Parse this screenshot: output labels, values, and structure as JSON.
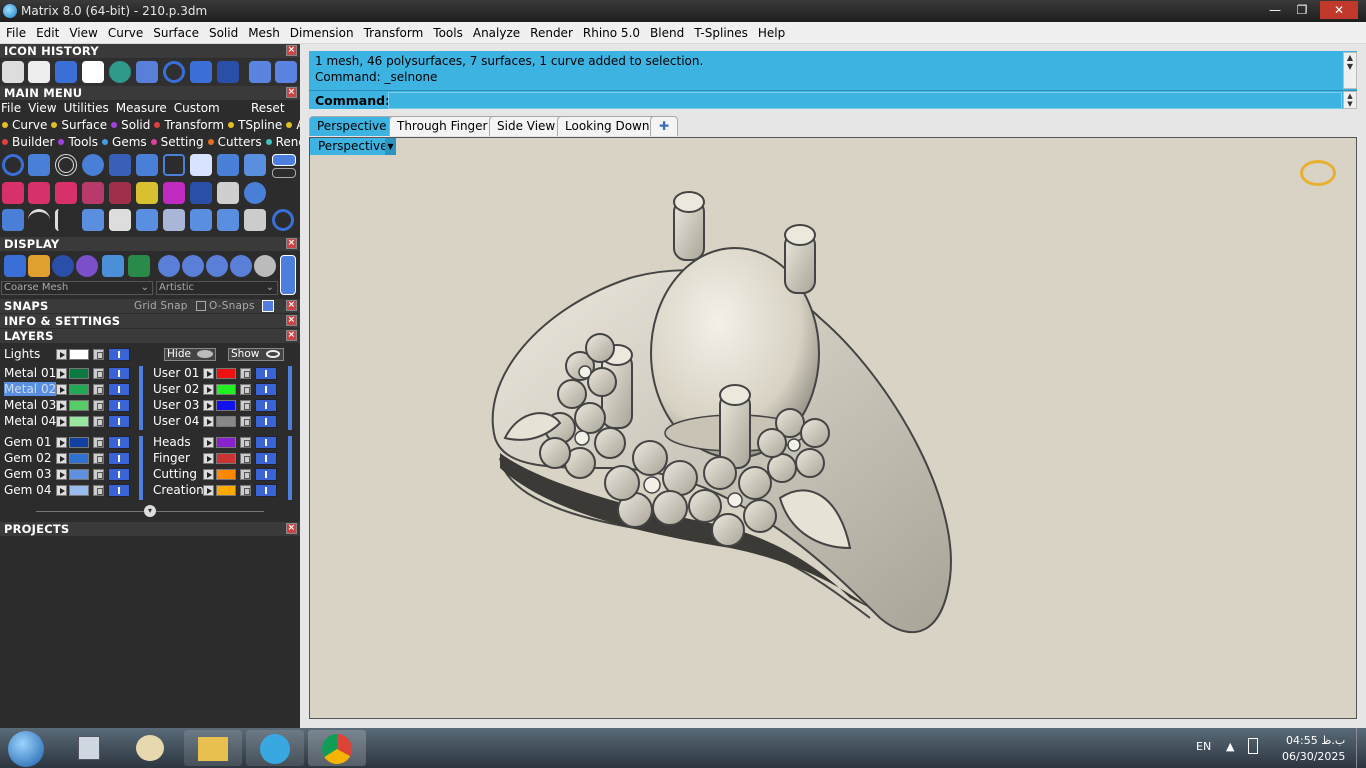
{
  "window": {
    "title": "Matrix 8.0 (64-bit) - 210.p.3dm",
    "min": "—",
    "restore": "❐",
    "close": "✕"
  },
  "menubar": [
    "File",
    "Edit",
    "View",
    "Curve",
    "Surface",
    "Solid",
    "Mesh",
    "Dimension",
    "Transform",
    "Tools",
    "Analyze",
    "Render",
    "Rhino 5.0",
    "Blend",
    "T-Splines",
    "Help"
  ],
  "panels": {
    "icon_history": "ICON HISTORY",
    "main_menu": "MAIN MENU",
    "display": "DISPLAY",
    "snaps": "SNAPS",
    "info_settings": "INFO & SETTINGS",
    "layers": "LAYERS",
    "projects": "PROJECTS"
  },
  "main_menu": {
    "items": [
      "File",
      "View",
      "Utilities",
      "Measure",
      "Custom"
    ],
    "reset": "Reset",
    "row1": [
      {
        "label": "Curve",
        "color": "#e0c020"
      },
      {
        "label": "Surface",
        "color": "#e0c020"
      },
      {
        "label": "Solid",
        "color": "#a040e0"
      },
      {
        "label": "Transform",
        "color": "#e04040"
      },
      {
        "label": "TSpline",
        "color": "#e0c020"
      },
      {
        "label": "Art",
        "color": "#e0c020"
      }
    ],
    "row2": [
      {
        "label": "Builder",
        "color": "#e04040"
      },
      {
        "label": "Tools",
        "color": "#a040e0"
      },
      {
        "label": "Gems",
        "color": "#40a0e0"
      },
      {
        "label": "Setting",
        "color": "#e040a0"
      },
      {
        "label": "Cutters",
        "color": "#e07020"
      },
      {
        "label": "Render",
        "color": "#40c0c0"
      }
    ]
  },
  "display": {
    "mesh_option": "Coarse Mesh",
    "style_option": "Artistic"
  },
  "snaps": {
    "grid_snap": "Grid Snap",
    "o_snaps": "O-Snaps"
  },
  "layers": {
    "lights": "Lights",
    "hide": "Hide",
    "show": "Show",
    "left": [
      {
        "name": "Metal 01",
        "color": "#0a7a40"
      },
      {
        "name": "Metal 02",
        "color": "#22a855"
      },
      {
        "name": "Metal 03",
        "color": "#55cc66"
      },
      {
        "name": "Metal 04",
        "color": "#99e6a0"
      },
      {
        "name": "Gem 01",
        "color": "#1040a0"
      },
      {
        "name": "Gem 02",
        "color": "#3070d0"
      },
      {
        "name": "Gem 03",
        "color": "#6090e0"
      },
      {
        "name": "Gem 04",
        "color": "#99bbee"
      }
    ],
    "right": [
      {
        "name": "User 01",
        "color": "#ee1111"
      },
      {
        "name": "User 02",
        "color": "#22ee22"
      },
      {
        "name": "User 03",
        "color": "#1111ee"
      },
      {
        "name": "User 04",
        "color": "#888888"
      },
      {
        "name": "Heads",
        "color": "#8822cc"
      },
      {
        "name": "Finger",
        "color": "#cc3333"
      },
      {
        "name": "Cutting",
        "color": "#ff8800"
      },
      {
        "name": "Creation",
        "color": "#ffaa00"
      }
    ]
  },
  "command": {
    "line1": "1 mesh, 46 polysurfaces, 7 surfaces, 1 curve added to selection.",
    "line2": "Command: _selnone",
    "prompt": "Command:"
  },
  "tabs": [
    "Perspective",
    "Through Finger",
    "Side View",
    "Looking Down"
  ],
  "add_tab": "✚",
  "viewport_label": "Perspective",
  "taskbar": {
    "lang": "EN",
    "time": "04:55 ب.ظ",
    "date": "06/30/2025"
  }
}
